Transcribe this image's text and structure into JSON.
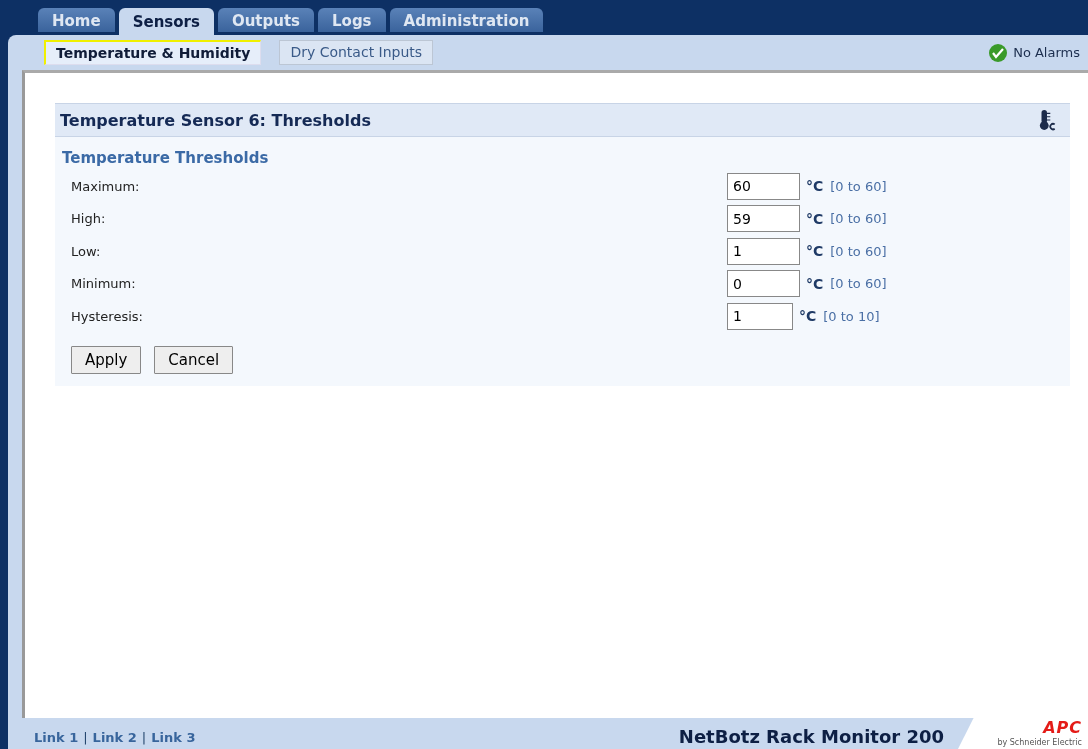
{
  "tabs": [
    {
      "label": "Home",
      "selected": false
    },
    {
      "label": "Sensors",
      "selected": true
    },
    {
      "label": "Outputs",
      "selected": false
    },
    {
      "label": "Logs",
      "selected": false
    },
    {
      "label": "Administration",
      "selected": false
    }
  ],
  "subtabs": [
    {
      "label": "Temperature & Humidity",
      "selected": true
    },
    {
      "label": "Dry Contact Inputs",
      "selected": false
    }
  ],
  "alarm_status": "No Alarms",
  "panel": {
    "title": "Temperature Sensor 6: Thresholds",
    "section": "Temperature Thresholds",
    "fields": [
      {
        "label": "Maximum:",
        "value": "60",
        "unit": "°C",
        "range": "[0 to 60]"
      },
      {
        "label": "High:",
        "value": "59",
        "unit": "°C",
        "range": "[0 to 60]"
      },
      {
        "label": "Low:",
        "value": "1",
        "unit": "°C",
        "range": "[0 to 60]"
      },
      {
        "label": "Minimum:",
        "value": "0",
        "unit": "°C",
        "range": "[0 to 60]"
      },
      {
        "label": "Hysteresis:",
        "value": "1",
        "unit": "°C",
        "range": "[0 to 10]"
      }
    ],
    "buttons": [
      "Apply",
      "Cancel"
    ]
  },
  "footer": {
    "links": [
      {
        "label": "Link 1",
        "kind": "link"
      },
      {
        "label": "|",
        "kind": "separator"
      },
      {
        "label": "Link 2",
        "kind": "link"
      },
      {
        "label": "|",
        "kind": "separator"
      },
      {
        "label": "Link 3",
        "kind": "link"
      }
    ],
    "product": "NetBotz Rack Monitor 200",
    "logo": "APC",
    "logo_tagline": "by Schneider Electric"
  }
}
